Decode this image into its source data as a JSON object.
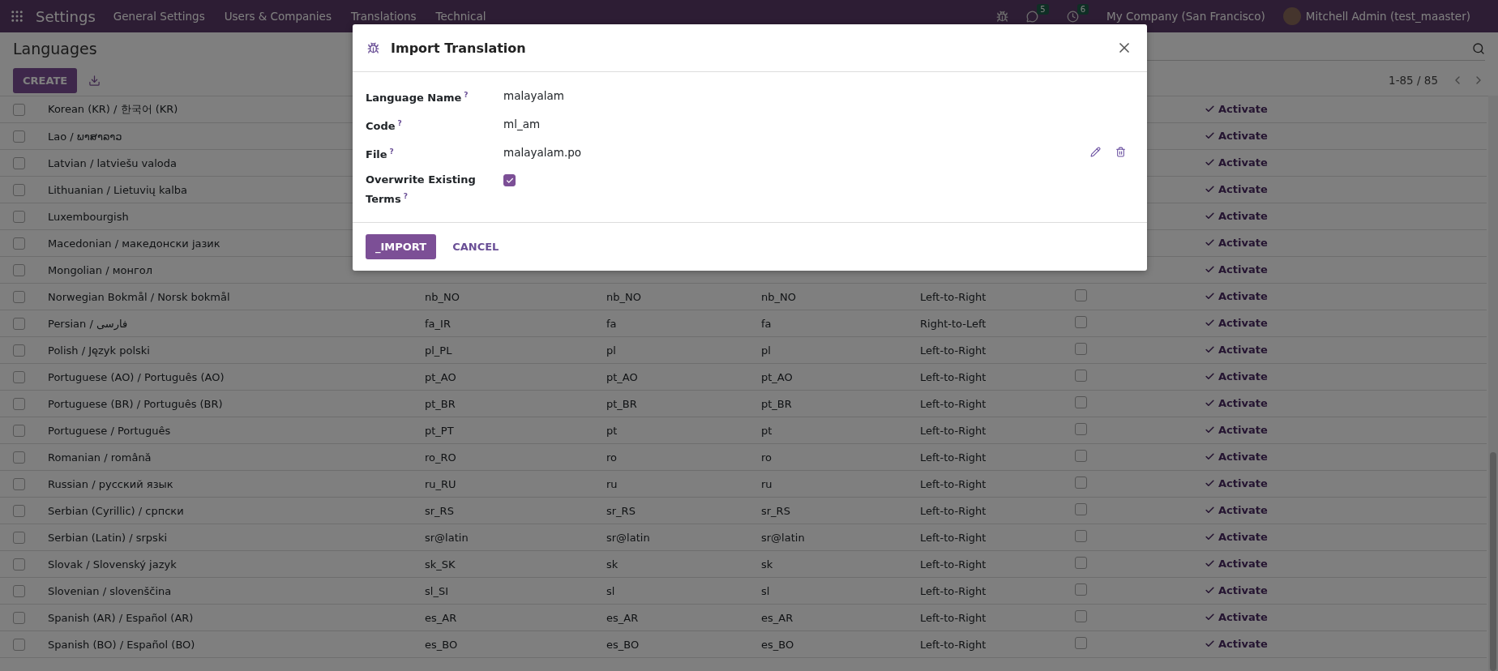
{
  "navbar": {
    "app": "Settings",
    "menu": [
      "General Settings",
      "Users & Companies",
      "Translations",
      "Technical"
    ],
    "chat_badge": "5",
    "activity_badge": "6",
    "company": "My Company (San Francisco)",
    "user": "Mitchell Admin (test_maaster)"
  },
  "control_panel": {
    "breadcrumb": "Languages",
    "create_button": "CREATE",
    "pager": "1-85 / 85"
  },
  "rows": [
    {
      "name": "Korean (KR) / 한국어 (KR)",
      "checked": false,
      "action": "Activate"
    },
    {
      "name": "Lao / ພາສາລາວ",
      "checked": false,
      "action": "Activate"
    },
    {
      "name": "Latvian / latviešu valoda",
      "checked": false,
      "action": "Activate"
    },
    {
      "name": "Lithuanian / Lietuvių kalba",
      "checked": false,
      "action": "Activate"
    },
    {
      "name": "Luxembourgish",
      "checked": false,
      "action": "Activate"
    },
    {
      "name": "Macedonian / македонски јазик",
      "checked": false,
      "action": "Activate"
    },
    {
      "name": "Mongolian / монгол",
      "checked": false,
      "action": "Activate"
    },
    {
      "name": "Norwegian Bokmål / Norsk bokmål",
      "checked": false,
      "code": "nb_NO",
      "iso": "nb_NO",
      "url": "nb_NO",
      "direction": "Left-to-Right",
      "active": false,
      "action": "Activate"
    },
    {
      "name": "Persian / فارسی",
      "checked": false,
      "code": "fa_IR",
      "iso": "fa",
      "url": "fa",
      "direction": "Right-to-Left",
      "active": false,
      "action": "Activate"
    },
    {
      "name": "Polish / Język polski",
      "checked": false,
      "code": "pl_PL",
      "iso": "pl",
      "url": "pl",
      "direction": "Left-to-Right",
      "active": false,
      "action": "Activate"
    },
    {
      "name": "Portuguese (AO) / Português (AO)",
      "checked": false,
      "code": "pt_AO",
      "iso": "pt_AO",
      "url": "pt_AO",
      "direction": "Left-to-Right",
      "active": false,
      "action": "Activate"
    },
    {
      "name": "Portuguese (BR) / Português (BR)",
      "checked": false,
      "code": "pt_BR",
      "iso": "pt_BR",
      "url": "pt_BR",
      "direction": "Left-to-Right",
      "active": false,
      "action": "Activate"
    },
    {
      "name": "Portuguese / Português",
      "checked": false,
      "code": "pt_PT",
      "iso": "pt",
      "url": "pt",
      "direction": "Left-to-Right",
      "active": false,
      "action": "Activate"
    },
    {
      "name": "Romanian / română",
      "checked": false,
      "code": "ro_RO",
      "iso": "ro",
      "url": "ro",
      "direction": "Left-to-Right",
      "active": false,
      "action": "Activate"
    },
    {
      "name": "Russian / русский язык",
      "checked": false,
      "code": "ru_RU",
      "iso": "ru",
      "url": "ru",
      "direction": "Left-to-Right",
      "active": false,
      "action": "Activate"
    },
    {
      "name": "Serbian (Cyrillic) / српски",
      "checked": false,
      "code": "sr_RS",
      "iso": "sr_RS",
      "url": "sr_RS",
      "direction": "Left-to-Right",
      "active": false,
      "action": "Activate"
    },
    {
      "name": "Serbian (Latin) / srpski",
      "checked": false,
      "code": "sr@latin",
      "iso": "sr@latin",
      "url": "sr@latin",
      "direction": "Left-to-Right",
      "active": false,
      "action": "Activate"
    },
    {
      "name": "Slovak / Slovenský jazyk",
      "checked": false,
      "code": "sk_SK",
      "iso": "sk",
      "url": "sk",
      "direction": "Left-to-Right",
      "active": false,
      "action": "Activate"
    },
    {
      "name": "Slovenian / slovenščina",
      "checked": false,
      "code": "sl_SI",
      "iso": "sl",
      "url": "sl",
      "direction": "Left-to-Right",
      "active": false,
      "action": "Activate"
    },
    {
      "name": "Spanish (AR) / Español (AR)",
      "checked": false,
      "code": "es_AR",
      "iso": "es_AR",
      "url": "es_AR",
      "direction": "Left-to-Right",
      "active": false,
      "action": "Activate"
    },
    {
      "name": "Spanish (BO) / Español (BO)",
      "checked": false,
      "code": "es_BO",
      "iso": "es_BO",
      "url": "es_BO",
      "direction": "Left-to-Right",
      "active": false,
      "action": "Activate"
    }
  ],
  "dialog": {
    "title": "Import Translation",
    "fields": [
      {
        "kind": "text",
        "label": "Language Name",
        "help": "?",
        "value": "malayalam"
      },
      {
        "kind": "text",
        "label": "Code",
        "help": "?",
        "value": "ml_am"
      },
      {
        "kind": "file",
        "label": "File",
        "help": "?",
        "value": "malayalam.po"
      },
      {
        "kind": "checkbox",
        "label": "Overwrite Existing Terms",
        "help": "?",
        "checked": true
      }
    ],
    "primary_button": "_IMPORT",
    "cancel_button": "CANCEL"
  }
}
